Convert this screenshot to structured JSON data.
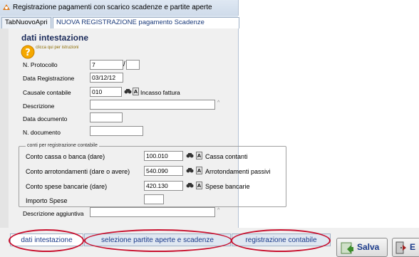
{
  "window": {
    "title": "Registrazione pagamenti con scarico scadenze e partite aperte"
  },
  "tabs": [
    {
      "label": "TabNuovoApri"
    },
    {
      "label": "NUOVA REGISTRAZIONE pagamento Scadenze"
    }
  ],
  "section": {
    "title": "dati intestazione",
    "help_link": "clicca qui per istruzioni"
  },
  "form": {
    "protocollo": {
      "label": "N. Protocollo",
      "value": "7",
      "suffix": ""
    },
    "data_registrazione": {
      "label": "Data Registrazione",
      "value": "03/12/12"
    },
    "causale": {
      "label": "Causale contabile",
      "code": "010",
      "description": "Incasso fattura"
    },
    "descrizione": {
      "label": "Descrizione",
      "value": ""
    },
    "data_documento": {
      "label": "Data documento",
      "value": ""
    },
    "n_documento": {
      "label": "N. documento",
      "value": ""
    }
  },
  "conti": {
    "legend": "conti per registrazione contabile",
    "cassa": {
      "label": "Conto cassa o banca (dare)",
      "code": "100.010",
      "description": "Cassa contanti"
    },
    "arrotondamenti": {
      "label": "Conto arrotondamenti (dare o avere)",
      "code": "540.090",
      "description": "Arrotondamenti passivi"
    },
    "spese": {
      "label": "Conto spese bancarie (dare)",
      "code": "420.130",
      "description": "Spese bancarie"
    },
    "importo_spese": {
      "label": "Importo Spese",
      "value": ""
    }
  },
  "descrizione_aggiuntiva": {
    "label": "Descrizione aggiuntiva",
    "value": ""
  },
  "bottom_tabs": [
    {
      "label": "dati intestazione"
    },
    {
      "label": "selezione partite aperte e scadenze"
    },
    {
      "label": "registrazione contabile"
    }
  ],
  "buttons": {
    "save": "Salva",
    "exit": "E"
  },
  "icons": {
    "search": "binoculars-icon",
    "lookup_a": "A"
  },
  "colors": {
    "highlight_oval": "#c8102e",
    "help_icon": "#f5a800",
    "tab_text": "#1a3a8a"
  }
}
